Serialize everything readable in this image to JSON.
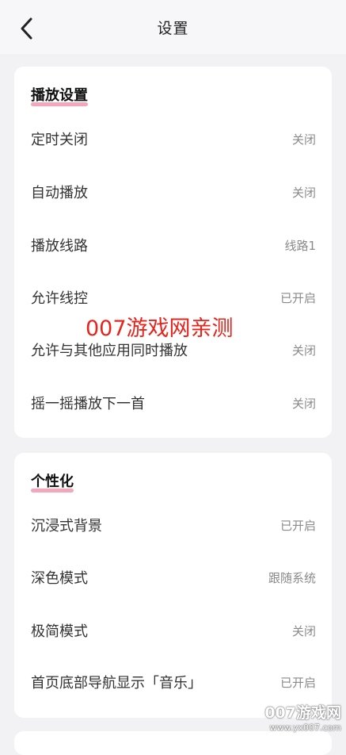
{
  "header": {
    "title": "设置",
    "back_icon": "chevron-left-icon"
  },
  "playback": {
    "section_title": "播放设置",
    "items": [
      {
        "label": "定时关闭",
        "value": "关闭"
      },
      {
        "label": "自动播放",
        "value": "关闭"
      },
      {
        "label": "播放线路",
        "value": "线路1"
      },
      {
        "label": "允许线控",
        "value": "已开启"
      },
      {
        "label": "允许与其他应用同时播放",
        "value": "关闭"
      },
      {
        "label": "摇一摇播放下一首",
        "value": "关闭"
      }
    ]
  },
  "personalization": {
    "section_title": "个性化",
    "items": [
      {
        "label": "沉浸式背景",
        "value": "已开启"
      },
      {
        "label": "深色模式",
        "value": "跟随系统"
      },
      {
        "label": "极简模式",
        "value": "关闭"
      },
      {
        "label": "首页底部导航显示「音乐」",
        "value": "已开启"
      }
    ]
  },
  "watermark": {
    "text": "007游戏网亲测"
  },
  "corner_watermark": {
    "line1": "007游戏网",
    "line2": "www.yx007.com"
  },
  "colors": {
    "accent_underline": "#f08aa3",
    "watermark_red": "#e8231b"
  }
}
